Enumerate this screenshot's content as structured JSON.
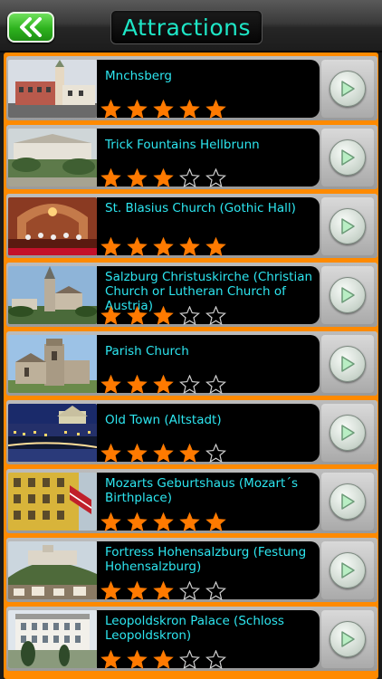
{
  "header": {
    "title": "Attractions",
    "back_icon": "double-chevron-left-icon",
    "accent_color": "#1ee6c6",
    "back_color": "#2eb31e"
  },
  "list": {
    "border_color": "#ff8a00",
    "star_color": "#ff7a00",
    "items": [
      {
        "title": "Mnchsberg",
        "rating": 5,
        "thumb": "building-red-tower"
      },
      {
        "title": "Trick Fountains Hellbrunn",
        "rating": 3,
        "thumb": "palace-garden"
      },
      {
        "title": "St. Blasius Church (Gothic Hall)",
        "rating": 5,
        "thumb": "gothic-hall-concert"
      },
      {
        "title": "Salzburg Christuskirche (Christian Church or Lutheran Church of Austria)",
        "rating": 3,
        "thumb": "church-spire"
      },
      {
        "title": "Parish Church",
        "rating": 3,
        "thumb": "church-tower"
      },
      {
        "title": "Old Town (Altstadt)",
        "rating": 4,
        "thumb": "night-city"
      },
      {
        "title": "Mozarts Geburtshaus (Mozart´s Birthplace)",
        "rating": 5,
        "thumb": "yellow-facade"
      },
      {
        "title": "Fortress Hohensalzburg (Festung Hohensalzburg)",
        "rating": 3,
        "thumb": "fortress-hill"
      },
      {
        "title": "Leopoldskron Palace (Schloss Leopoldskron)",
        "rating": 3,
        "thumb": "white-palace"
      }
    ]
  }
}
